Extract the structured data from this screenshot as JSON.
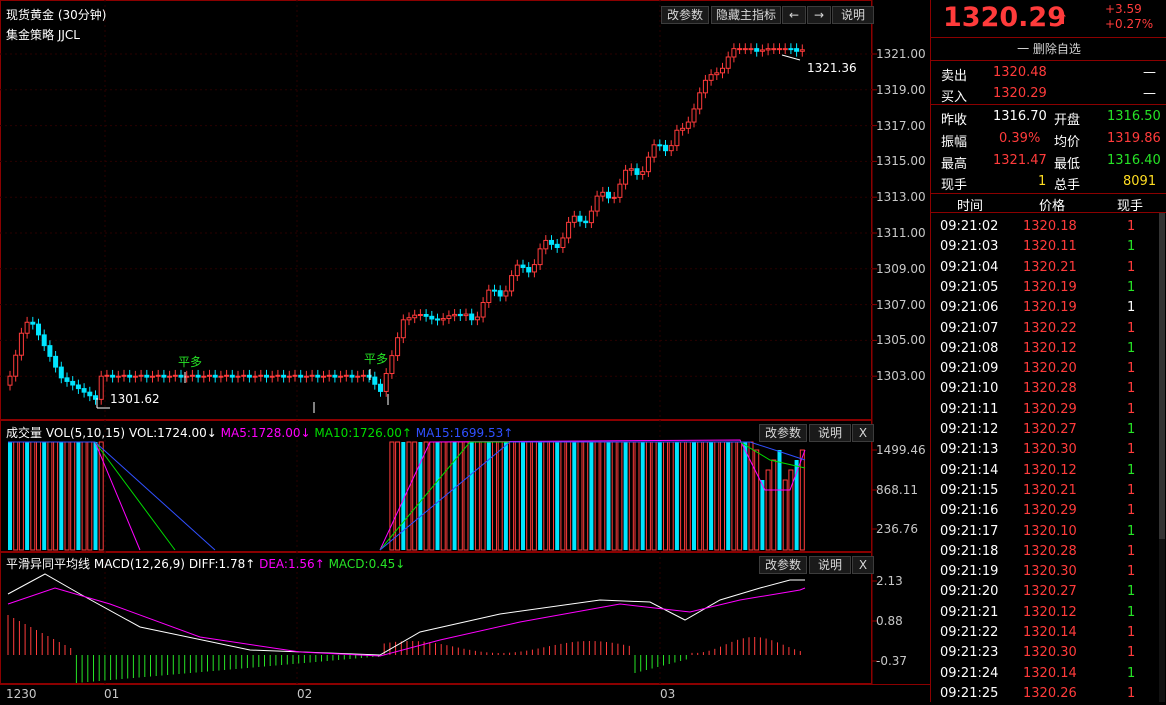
{
  "main_chart": {
    "title": "现货黄金 (30分钟)",
    "strategy": "集金策略 JJCL",
    "buttons": [
      "改参数",
      "隐藏主指标",
      "←",
      "→",
      "说明"
    ],
    "price_axis": [
      "1321.00",
      "1319.00",
      "1317.00",
      "1315.00",
      "1313.00",
      "1311.00",
      "1309.00",
      "1307.00",
      "1305.00",
      "1303.00"
    ],
    "high_label": "1321.36",
    "low_label": "1301.62",
    "signals": [
      "平多",
      "平多"
    ]
  },
  "volume_pane": {
    "title": "成交量 VOL(5,10,15)",
    "vol": "VOL:1724.00↓",
    "ma5": "MA5:1728.00↓",
    "ma10": "MA10:1726.00↑",
    "ma15": "MA15:1699.53↑",
    "buttons": [
      "改参数",
      "说明",
      "X"
    ],
    "axis": [
      "1499.46",
      "868.11",
      "236.76"
    ]
  },
  "macd_pane": {
    "title": "平滑异同平均线",
    "params": "MACD(12,26,9)",
    "diff": "DIFF:1.78↑",
    "dea": "DEA:1.56↑",
    "macd": "MACD:0.45↓",
    "buttons": [
      "改参数",
      "说明",
      "X"
    ],
    "axis": [
      "2.13",
      "0.88",
      "-0.37"
    ]
  },
  "time_axis": [
    "1230",
    "01",
    "02",
    "03"
  ],
  "quote": {
    "price": "1320.29",
    "arrow": "⬆",
    "change": "+3.59",
    "change_pct": "+0.27%",
    "remove_fav": "一 删除自选",
    "sell_label": "卖出",
    "sell_price": "1320.48",
    "sell_vol": "—",
    "buy_label": "买入",
    "buy_price": "1320.29",
    "buy_vol": "—",
    "prev_close_label": "昨收",
    "prev_close": "1316.70",
    "open_label": "开盘",
    "open": "1316.50",
    "amp_label": "振幅",
    "amp": "0.39%",
    "avg_label": "均价",
    "avg": "1319.86",
    "high_label": "最高",
    "high": "1321.47",
    "low_label": "最低",
    "low": "1316.40",
    "cur_vol_label": "现手",
    "cur_vol": "1",
    "total_vol_label": "总手",
    "total_vol": "8091"
  },
  "trades": {
    "headers": [
      "时间",
      "价格",
      "现手"
    ],
    "rows": [
      {
        "time": "09:21:02",
        "price": "1320.18",
        "vol": "1",
        "c": "red"
      },
      {
        "time": "09:21:03",
        "price": "1320.11",
        "vol": "1",
        "c": "green"
      },
      {
        "time": "09:21:04",
        "price": "1320.21",
        "vol": "1",
        "c": "red"
      },
      {
        "time": "09:21:05",
        "price": "1320.19",
        "vol": "1",
        "c": "green"
      },
      {
        "time": "09:21:06",
        "price": "1320.19",
        "vol": "1",
        "c": "white"
      },
      {
        "time": "09:21:07",
        "price": "1320.22",
        "vol": "1",
        "c": "red"
      },
      {
        "time": "09:21:08",
        "price": "1320.12",
        "vol": "1",
        "c": "green"
      },
      {
        "time": "09:21:09",
        "price": "1320.20",
        "vol": "1",
        "c": "red"
      },
      {
        "time": "09:21:10",
        "price": "1320.28",
        "vol": "1",
        "c": "red"
      },
      {
        "time": "09:21:11",
        "price": "1320.29",
        "vol": "1",
        "c": "red"
      },
      {
        "time": "09:21:12",
        "price": "1320.27",
        "vol": "1",
        "c": "green"
      },
      {
        "time": "09:21:13",
        "price": "1320.30",
        "vol": "1",
        "c": "red"
      },
      {
        "time": "09:21:14",
        "price": "1320.12",
        "vol": "1",
        "c": "green"
      },
      {
        "time": "09:21:15",
        "price": "1320.21",
        "vol": "1",
        "c": "red"
      },
      {
        "time": "09:21:16",
        "price": "1320.29",
        "vol": "1",
        "c": "red"
      },
      {
        "time": "09:21:17",
        "price": "1320.10",
        "vol": "1",
        "c": "green"
      },
      {
        "time": "09:21:18",
        "price": "1320.28",
        "vol": "1",
        "c": "red"
      },
      {
        "time": "09:21:19",
        "price": "1320.30",
        "vol": "1",
        "c": "red"
      },
      {
        "time": "09:21:20",
        "price": "1320.27",
        "vol": "1",
        "c": "green"
      },
      {
        "time": "09:21:21",
        "price": "1320.12",
        "vol": "1",
        "c": "green"
      },
      {
        "time": "09:21:22",
        "price": "1320.14",
        "vol": "1",
        "c": "red"
      },
      {
        "time": "09:21:23",
        "price": "1320.30",
        "vol": "1",
        "c": "red"
      },
      {
        "time": "09:21:24",
        "price": "1320.14",
        "vol": "1",
        "c": "green"
      },
      {
        "time": "09:21:25",
        "price": "1320.26",
        "vol": "1",
        "c": "red"
      }
    ]
  },
  "colors": {
    "up": "#ff3b3b",
    "down": "#00e5ff",
    "ma5": "#ff00ff",
    "ma10": "#00dd00",
    "ma15": "#3050ff",
    "diff": "#ffffff",
    "dea": "#ff00ff",
    "grid": "#2a0000",
    "border": "#8b0000"
  }
}
